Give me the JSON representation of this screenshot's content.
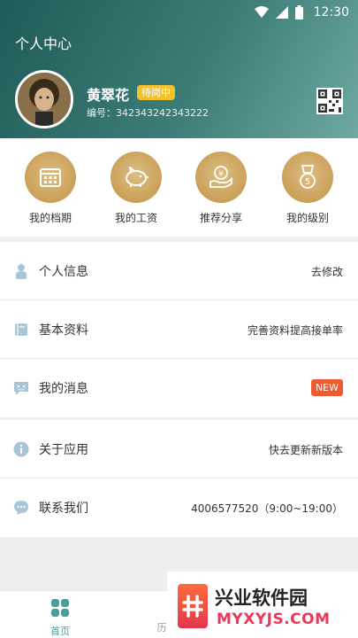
{
  "status_bar": {
    "time": "12:30"
  },
  "header": {
    "title": "个人中心",
    "user_name": "黄翠花",
    "status_badge": "待岗中",
    "id_label": "编号：",
    "id_value": "342343242343222"
  },
  "quick_actions": [
    {
      "label": "我的档期",
      "icon": "calendar-icon"
    },
    {
      "label": "我的工资",
      "icon": "piggy-bank-icon"
    },
    {
      "label": "推荐分享",
      "icon": "yen-coin-hand-icon"
    },
    {
      "label": "我的级别",
      "icon": "medal-icon"
    }
  ],
  "menu": {
    "group1": [
      {
        "label": "个人信息",
        "value": "去修改",
        "icon": "person-icon"
      },
      {
        "label": "基本资料",
        "value": "完善资料提高接单率",
        "icon": "book-icon"
      },
      {
        "label": "我的消息",
        "value": "NEW",
        "icon": "message-icon"
      }
    ],
    "group2": [
      {
        "label": "关于应用",
        "value": "快去更新新版本",
        "icon": "info-icon"
      },
      {
        "label": "联系我们",
        "value": "4006577520（9:00~19:00）",
        "icon": "chat-icon"
      }
    ]
  },
  "tabbar": [
    {
      "label": "首页",
      "icon": "home-grid-icon"
    },
    {
      "label": "历",
      "icon": "history-icon"
    }
  ],
  "watermark": {
    "title": "兴业软件园",
    "url": "MYXYJS.COM"
  },
  "colors": {
    "header_start": "#1f5b58",
    "header_end": "#6ea9a2",
    "gold": "#c99e55",
    "badge": "#f5c12b",
    "new": "#f05a32",
    "tab_active": "#4a9d98"
  }
}
